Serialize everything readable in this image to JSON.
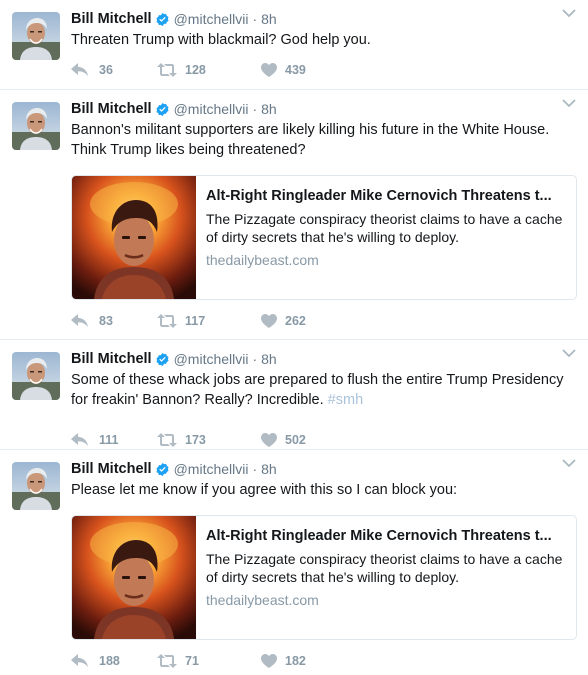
{
  "author": {
    "name": "Bill Mitchell",
    "handle": "@mitchellvii"
  },
  "colors": {
    "verified": "#1da1f2",
    "icon_gray": "#b1bbc3",
    "link_muted": "#8899a6",
    "hashtag": "#a9c3da"
  },
  "tweets": [
    {
      "time": "8h",
      "text": "Threaten Trump with blackmail?  God help you.",
      "replies": "36",
      "retweets": "128",
      "likes": "439"
    },
    {
      "time": "8h",
      "text": "Bannon's militant supporters are likely killing his future in the White House.  Think Trump likes being threatened?",
      "card": {
        "title": "Alt-Right Ringleader Mike Cernovich Threatens t...",
        "description": "The Pizzagate conspiracy theorist claims to have a cache of dirty secrets that he's willing to deploy.",
        "domain": "thedailybeast.com"
      },
      "replies": "83",
      "retweets": "117",
      "likes": "262"
    },
    {
      "time": "8h",
      "text": "Some of these whack jobs are prepared to flush the entire Trump Presidency for freakin' Bannon?  Really?  Incredible.",
      "hashtag": "#smh",
      "replies": "111",
      "retweets": "173",
      "likes": "502"
    },
    {
      "time": "8h",
      "text": "Please let me know if you agree with this so I can block you:",
      "card": {
        "title": "Alt-Right Ringleader Mike Cernovich Threatens t...",
        "description": "The Pizzagate conspiracy theorist claims to have a cache of dirty secrets that he's willing to deploy.",
        "domain": "thedailybeast.com"
      },
      "replies": "188",
      "retweets": "71",
      "likes": "182"
    }
  ]
}
